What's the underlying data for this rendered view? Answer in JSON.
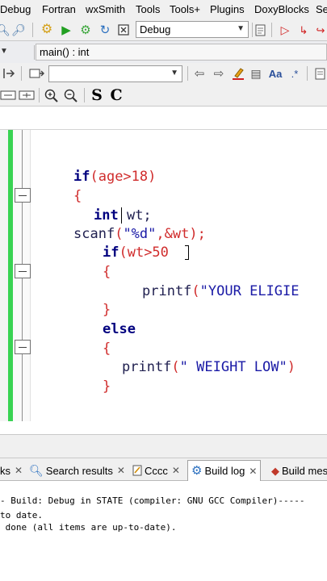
{
  "menubar": {
    "items": [
      "Debug",
      "Fortran",
      "wxSmith",
      "Tools",
      "Tools+",
      "Plugins",
      "DoxyBlocks",
      "Set"
    ]
  },
  "toolbar1": {
    "build_target": "Debug"
  },
  "toolbar2": {
    "code_completion_scope": "",
    "code_completion_function": "main() : int"
  },
  "toolbar3": {
    "search_text": ""
  },
  "toolbar4": {
    "selection_s": "S",
    "selection_c": "C"
  },
  "editor": {
    "lines": {
      "l1_kw": "if",
      "l1_rest": "(age>18)",
      "l2": "{",
      "l3_kw": "int",
      "l3_rest": " wt;",
      "l4_fn": "scanf",
      "l4_open": "(",
      "l4_str": "\"%d\"",
      "l4_rest": ",&wt);",
      "l5_kw": "if",
      "l5_rest": "(wt>50",
      "l6": "{",
      "l7_fn": "printf",
      "l7_open": "(",
      "l7_str": "\"YOUR ELIGIE",
      "l8": "}",
      "l9_kw": "else",
      "l10": "{",
      "l11_fn": "printf",
      "l11_open": "(",
      "l11_str": "\" WEIGHT LOW\"",
      "l11_rest": ")",
      "l12": "}"
    }
  },
  "logs_tabs": [
    {
      "label": "ks"
    },
    {
      "label": "Search results"
    },
    {
      "label": "Cccc"
    },
    {
      "label": "Build log"
    },
    {
      "label": "Build mes"
    }
  ],
  "build_log": {
    "line1": "- Build: Debug in STATE (compiler: GNU GCC Compiler)-----",
    "line2": "to date.",
    "line3": " done (all items are up-to-date)."
  },
  "colors": {
    "keyword": "#00007f",
    "operator": "#d02c2c",
    "string": "#1a1aa6",
    "changebar": "#39d353"
  }
}
